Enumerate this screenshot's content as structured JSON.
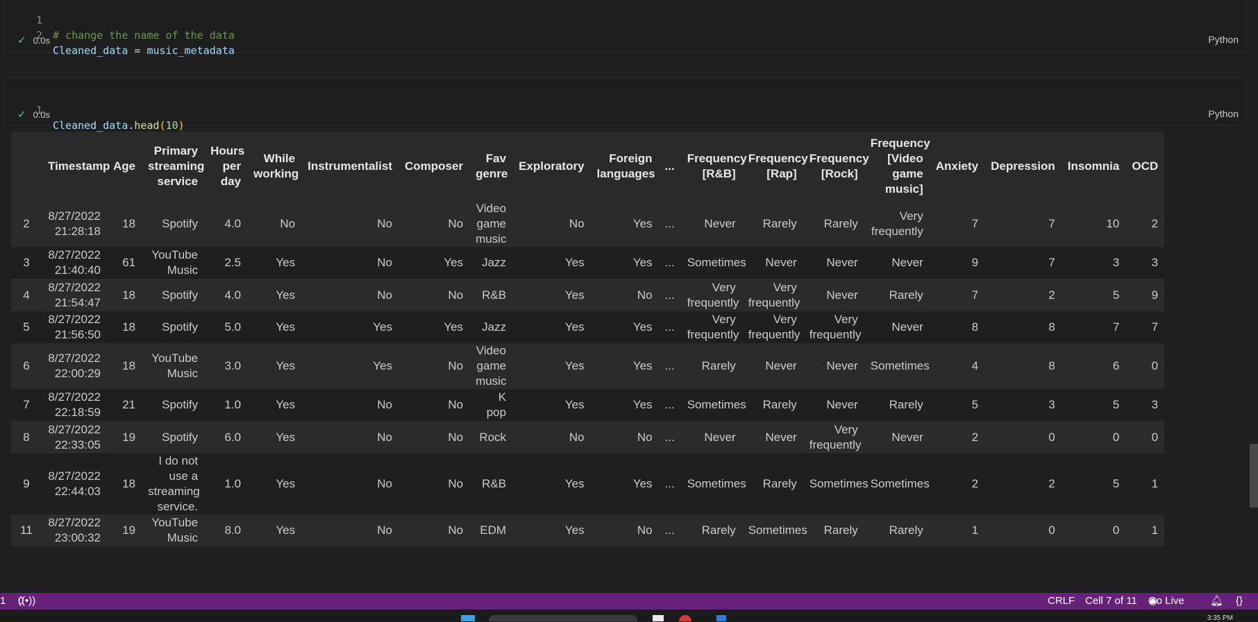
{
  "cell1": {
    "lines": [
      {
        "num": "1",
        "comment": "# change the name of the data"
      },
      {
        "num": "2",
        "var": "Cleaned_data",
        "op": " = ",
        "rhs": "music_metadata"
      }
    ],
    "exec_time": "0.0s",
    "language": "Python"
  },
  "cell2": {
    "line_num": "1",
    "var": "Cleaned_data",
    "dot": ".",
    "fn": "head",
    "open": "(",
    "arg": "10",
    "close": ")",
    "exec_time": "0.0s",
    "language": "Python"
  },
  "table": {
    "columns": [
      "",
      "Timestamp",
      "Age",
      "Primary streaming service",
      "Hours per day",
      "While working",
      "Instrumentalist",
      "Composer",
      "Fav genre",
      "Exploratory",
      "Foreign languages",
      "...",
      "Frequency [R&B]",
      "Frequency [Rap]",
      "Frequency [Rock]",
      "Frequency [Video game music]",
      "Anxiety",
      "Depression",
      "Insomnia",
      "OCD"
    ],
    "rows": [
      [
        "2",
        "8/27/2022 21:28:18",
        "18",
        "Spotify",
        "4.0",
        "No",
        "No",
        "No",
        "Video game music",
        "No",
        "Yes",
        "...",
        "Never",
        "Rarely",
        "Rarely",
        "Very frequently",
        "7",
        "7",
        "10",
        "2"
      ],
      [
        "3",
        "8/27/2022 21:40:40",
        "61",
        "YouTube Music",
        "2.5",
        "Yes",
        "No",
        "Yes",
        "Jazz",
        "Yes",
        "Yes",
        "...",
        "Sometimes",
        "Never",
        "Never",
        "Never",
        "9",
        "7",
        "3",
        "3"
      ],
      [
        "4",
        "8/27/2022 21:54:47",
        "18",
        "Spotify",
        "4.0",
        "Yes",
        "No",
        "No",
        "R&B",
        "Yes",
        "No",
        "...",
        "Very frequently",
        "Very frequently",
        "Never",
        "Rarely",
        "7",
        "2",
        "5",
        "9"
      ],
      [
        "5",
        "8/27/2022 21:56:50",
        "18",
        "Spotify",
        "5.0",
        "Yes",
        "Yes",
        "Yes",
        "Jazz",
        "Yes",
        "Yes",
        "...",
        "Very frequently",
        "Very frequently",
        "Very frequently",
        "Never",
        "8",
        "8",
        "7",
        "7"
      ],
      [
        "6",
        "8/27/2022 22:00:29",
        "18",
        "YouTube Music",
        "3.0",
        "Yes",
        "Yes",
        "No",
        "Video game music",
        "Yes",
        "Yes",
        "...",
        "Rarely",
        "Never",
        "Never",
        "Sometimes",
        "4",
        "8",
        "6",
        "0"
      ],
      [
        "7",
        "8/27/2022 22:18:59",
        "21",
        "Spotify",
        "1.0",
        "Yes",
        "No",
        "No",
        "K pop",
        "Yes",
        "Yes",
        "...",
        "Sometimes",
        "Rarely",
        "Never",
        "Rarely",
        "5",
        "3",
        "5",
        "3"
      ],
      [
        "8",
        "8/27/2022 22:33:05",
        "19",
        "Spotify",
        "6.0",
        "Yes",
        "No",
        "No",
        "Rock",
        "No",
        "No",
        "...",
        "Never",
        "Never",
        "Very frequently",
        "Never",
        "2",
        "0",
        "0",
        "0"
      ],
      [
        "9",
        "8/27/2022 22:44:03",
        "18",
        "I do not use a streaming service.",
        "1.0",
        "Yes",
        "No",
        "No",
        "R&B",
        "Yes",
        "Yes",
        "...",
        "Sometimes",
        "Rarely",
        "Sometimes",
        "Sometimes",
        "2",
        "2",
        "5",
        "1"
      ],
      [
        "11",
        "8/27/2022 23:00:32",
        "19",
        "YouTube Music",
        "8.0",
        "Yes",
        "No",
        "No",
        "EDM",
        "Yes",
        "No",
        "...",
        "Rarely",
        "Sometimes",
        "Rarely",
        "Rarely",
        "1",
        "0",
        "0",
        "1"
      ]
    ]
  },
  "statusbar": {
    "left_num": "1",
    "ports_count": "0",
    "eol": "CRLF",
    "cell_info": "Cell 7 of 11",
    "go_live": "Go Live",
    "braces": "{}"
  },
  "taskbar": {
    "clock": "3:35 PM"
  },
  "colors": {
    "statusbar": "#68217a",
    "check": "#4ec9a0",
    "comment": "#6a9955"
  }
}
